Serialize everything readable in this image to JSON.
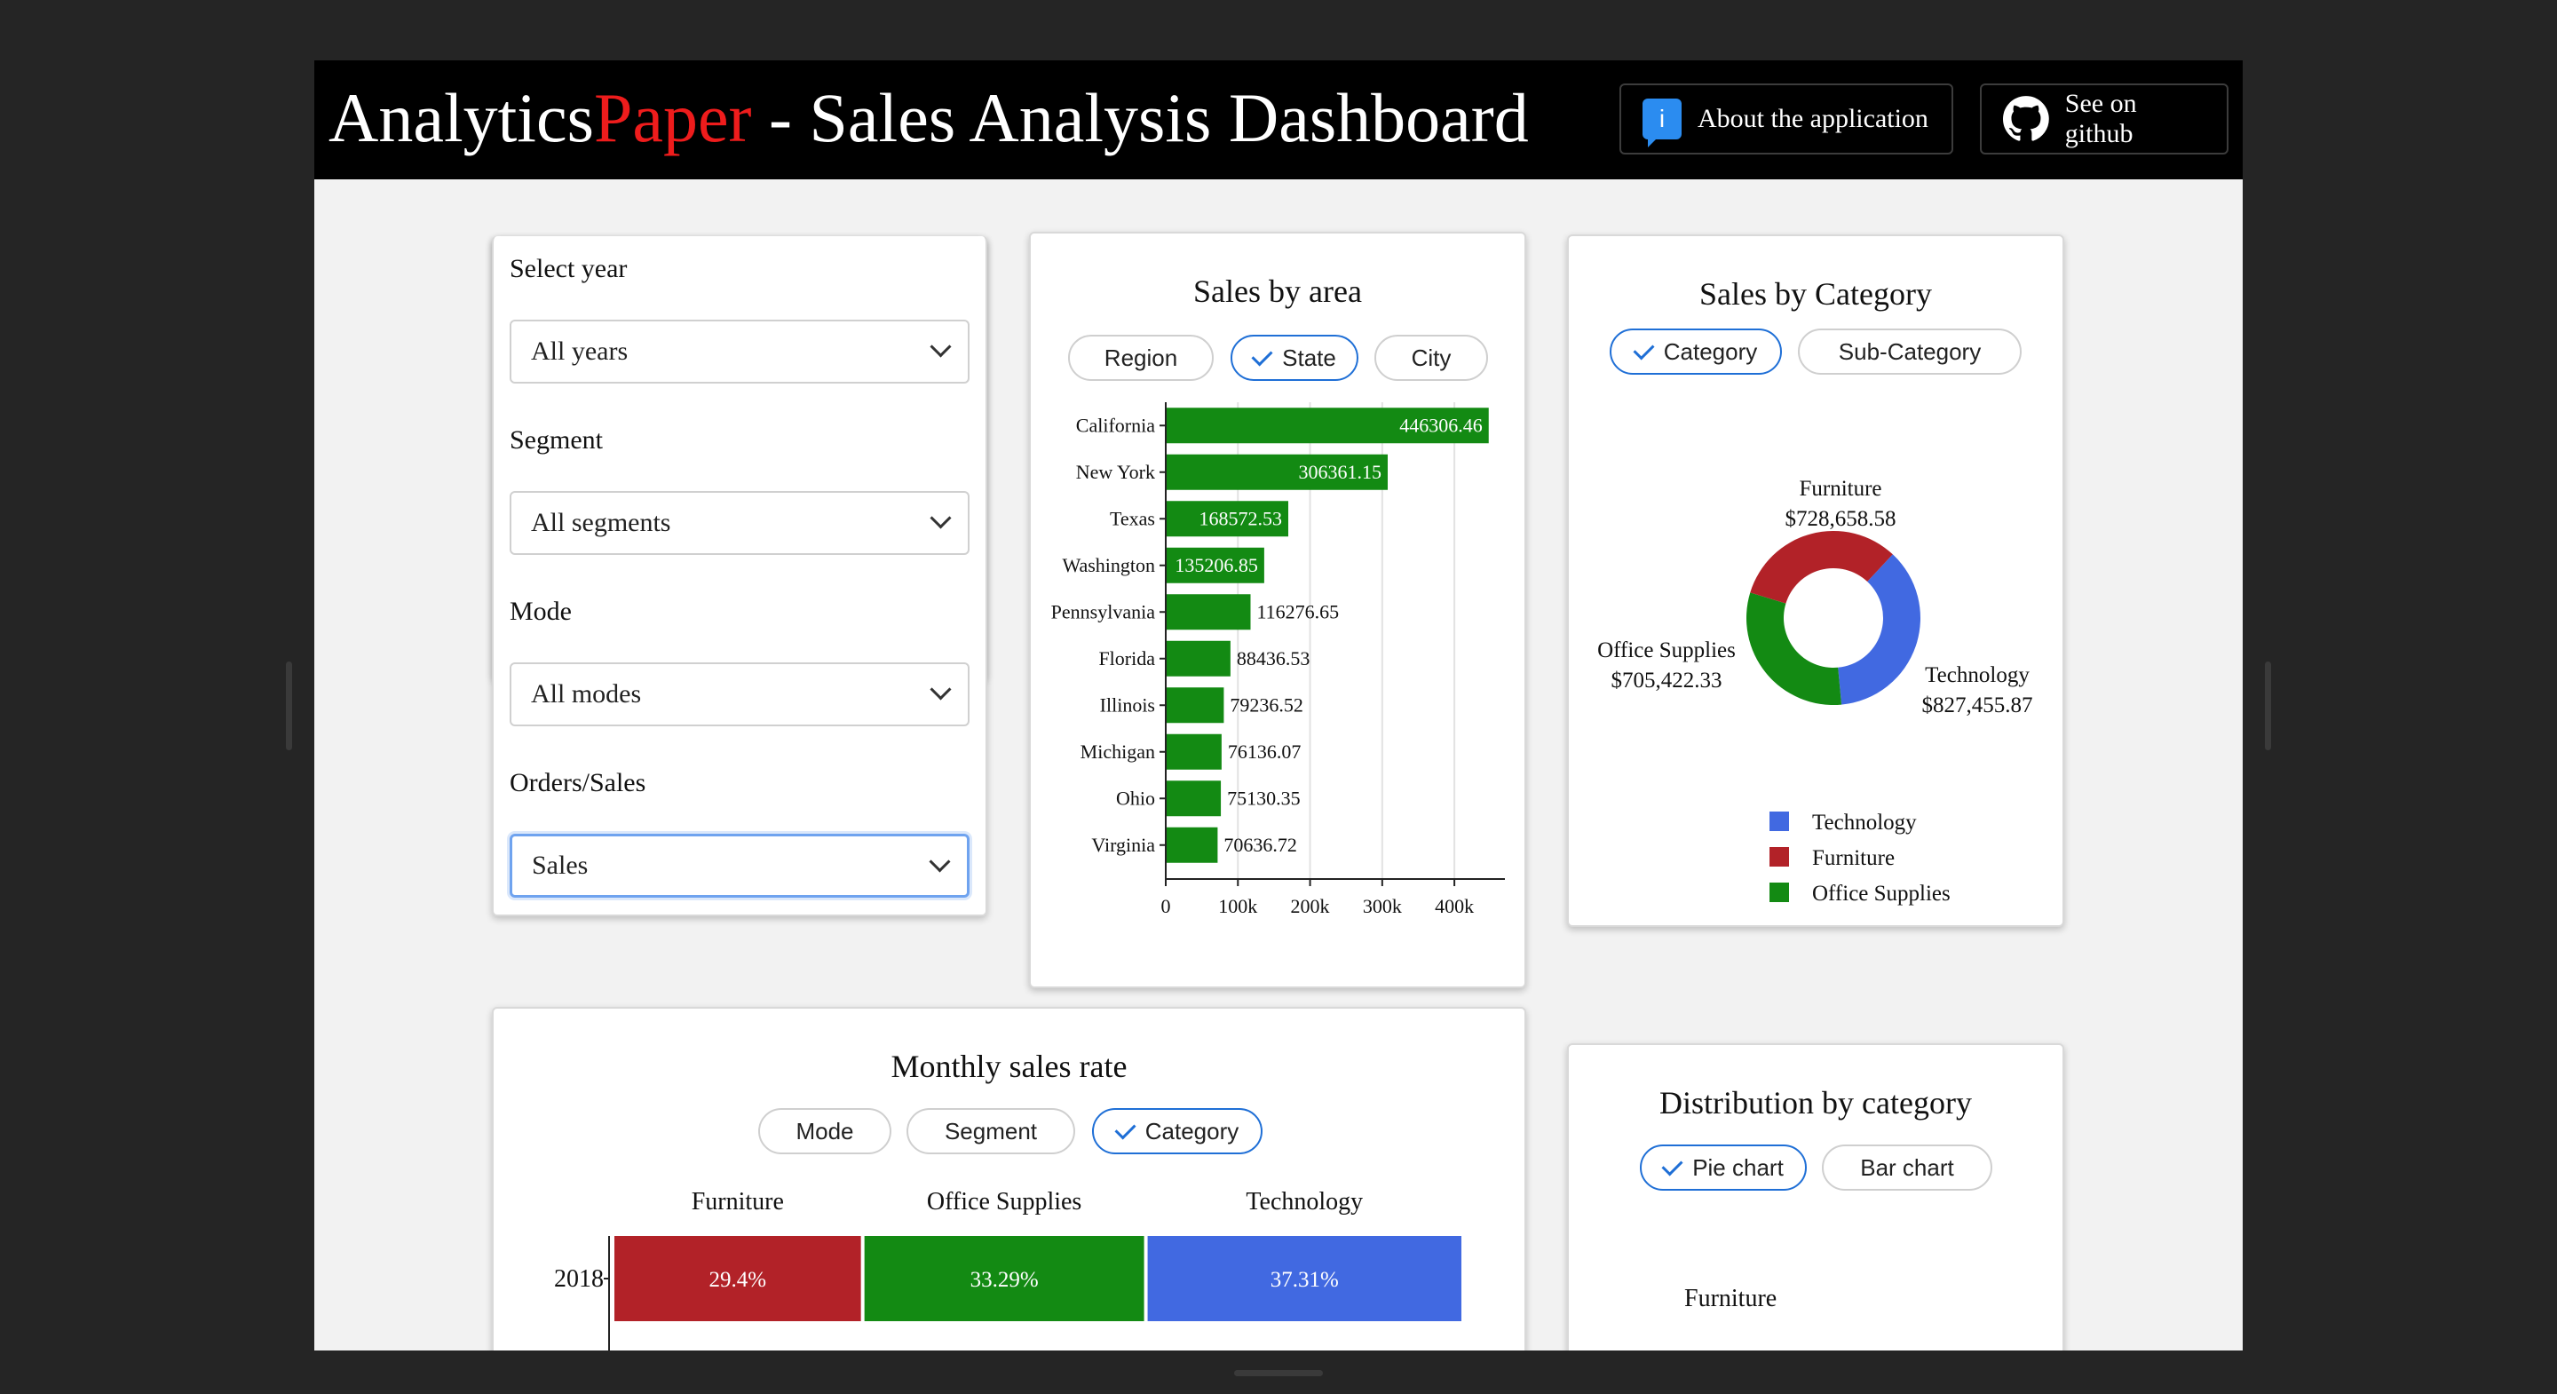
{
  "header": {
    "title_main": "Analytics",
    "title_accent": "Paper",
    "title_rest": " - Sales Analysis Dashboard",
    "about_label": "About the application",
    "github_label": "See on github",
    "info_glyph": "i",
    "icons": {
      "about": "info-icon",
      "github": "github-icon"
    }
  },
  "filters": {
    "year_label": "Select year",
    "year_value": "All years",
    "segment_label": "Segment",
    "segment_value": "All segments",
    "mode_label": "Mode",
    "mode_value": "All modes",
    "orders_label": "Orders/Sales",
    "orders_value": "Sales"
  },
  "area": {
    "title": "Sales by area",
    "toggles": [
      "Region",
      "State",
      "City"
    ],
    "selected": "State"
  },
  "category": {
    "title": "Sales by Category",
    "toggles": [
      "Category",
      "Sub-Category"
    ],
    "selected": "Category"
  },
  "monthly": {
    "title": "Monthly sales rate",
    "toggles": [
      "Mode",
      "Segment",
      "Category"
    ],
    "selected": "Category"
  },
  "distribution": {
    "title": "Distribution by category",
    "toggles": [
      "Pie chart",
      "Bar chart"
    ],
    "selected": "Pie chart",
    "partial_label": "Furniture"
  },
  "chart_data": [
    {
      "type": "bar",
      "orientation": "horizontal",
      "title": "Sales by area",
      "categories": [
        "California",
        "New York",
        "Texas",
        "Washington",
        "Pennsylvania",
        "Florida",
        "Illinois",
        "Michigan",
        "Ohio",
        "Virginia"
      ],
      "values": [
        446306.46,
        306361.15,
        168572.53,
        135206.85,
        116276.65,
        88436.53,
        79236.52,
        76136.07,
        75130.35,
        70636.72
      ],
      "value_labels": [
        "446306.46",
        "306361.15",
        "168572.53",
        "135206.85",
        "116276.65",
        "88436.53",
        "79236.52",
        "76136.07",
        "75130.35",
        "70636.72"
      ],
      "x_ticks": [
        "0",
        "100k",
        "200k",
        "300k",
        "400k"
      ],
      "xlim": [
        0,
        470000
      ],
      "grid": true,
      "color": "#138a13"
    },
    {
      "type": "pie",
      "style": "donut",
      "title": "Sales by Category",
      "categories": [
        "Technology",
        "Furniture",
        "Office Supplies"
      ],
      "values": [
        827455.87,
        728658.58,
        705422.33
      ],
      "value_labels": [
        "$827,455.87",
        "$728,658.58",
        "$705,422.33"
      ],
      "colors": [
        "#4169e1",
        "#b22228",
        "#138a13"
      ],
      "legend": "bottom"
    },
    {
      "type": "bar",
      "orientation": "horizontal-stacked-100",
      "title": "Monthly sales rate",
      "categories": [
        "2018"
      ],
      "series": [
        {
          "name": "Furniture",
          "values": [
            29.4
          ],
          "label": "29.4%",
          "color": "#b22228"
        },
        {
          "name": "Office Supplies",
          "values": [
            33.29
          ],
          "label": "33.29%",
          "color": "#138a13"
        },
        {
          "name": "Technology",
          "values": [
            37.31
          ],
          "label": "37.31%",
          "color": "#4169e1"
        }
      ]
    }
  ]
}
